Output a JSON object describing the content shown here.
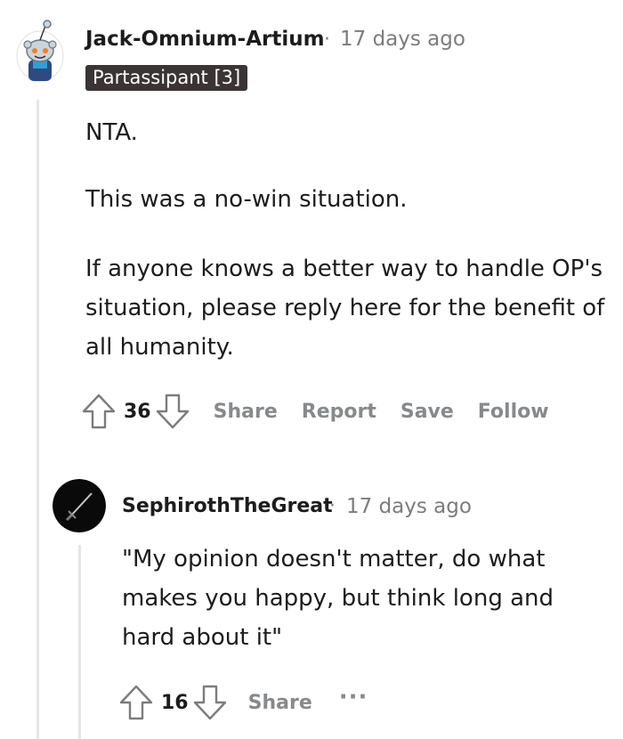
{
  "comment": {
    "author": "Jack-Omnium-Artium",
    "separator": "·",
    "time": "17 days ago",
    "flair": "Partassipant [3]",
    "paragraphs": [
      "NTA.",
      "This was a no-win situation.",
      "If anyone knows a better way to handle OP's situation, please reply here for the benefit of all humanity."
    ],
    "score": "36",
    "actions": {
      "share": "Share",
      "report": "Report",
      "save": "Save",
      "follow": "Follow"
    }
  },
  "reply": {
    "author": "SephirothTheGreat",
    "separator": "·",
    "time": "17 days ago",
    "body": "\"My opinion doesn't matter, do what makes you happy, but think long and hard about it\"",
    "score": "16",
    "actions": {
      "share": "Share",
      "more": "···"
    }
  },
  "icons": {
    "upvote": "upvote-arrow-icon",
    "downvote": "downvote-arrow-icon",
    "avatar_top": "snoo-avatar-icon",
    "avatar_reply": "sword-avatar-icon"
  },
  "colors": {
    "text": "#1c1c1c",
    "meta": "#7c7c7c",
    "action": "#878a8c",
    "flair_bg": "#3b3435",
    "thread_line": "#e6e6e6"
  }
}
